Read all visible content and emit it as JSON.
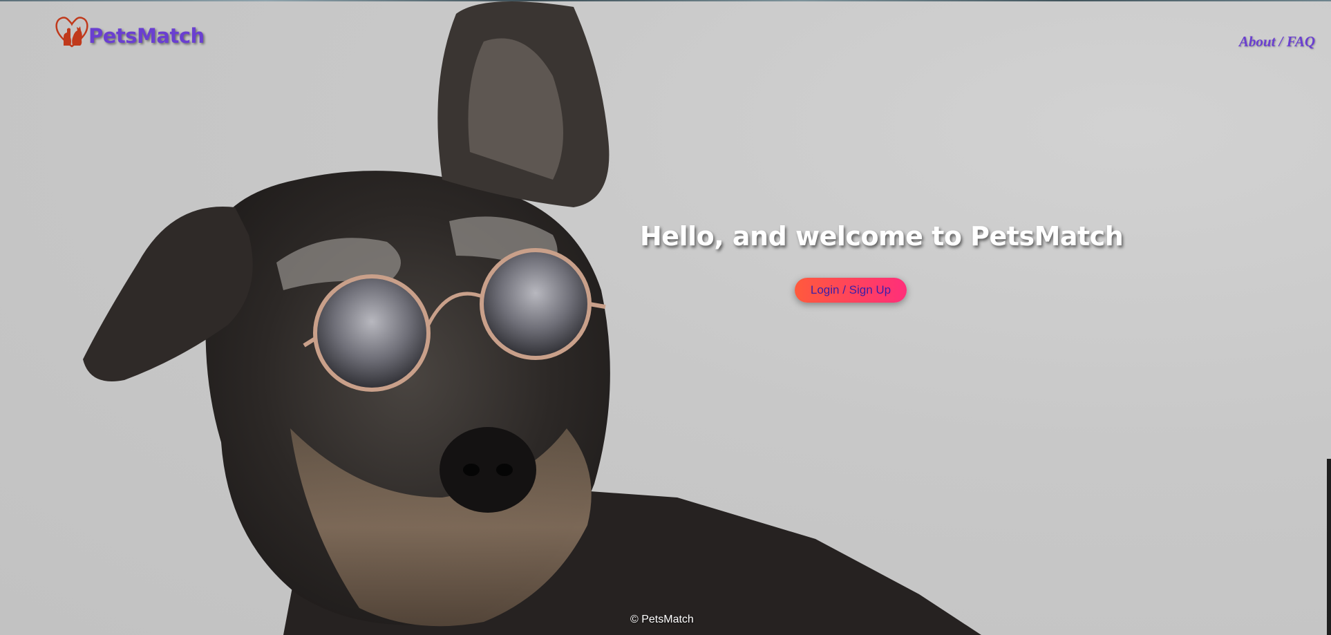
{
  "header": {
    "brand_name": "PetsMatch",
    "nav_link": "About / FAQ"
  },
  "hero": {
    "title": "Hello, and welcome to PetsMatch",
    "cta_label": "Login / Sign Up",
    "image": "schnauzer-with-sunglasses"
  },
  "footer": {
    "copyright": "© PetsMatch"
  },
  "colors": {
    "brand": "#6a3fd0",
    "logo_icon": "#c0391b",
    "cta_start": "#ff5a3c",
    "cta_end": "#ff2e7a",
    "background": "#c9c9c9"
  }
}
